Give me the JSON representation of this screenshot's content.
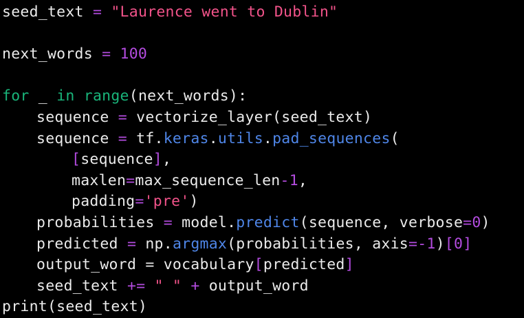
{
  "colors": {
    "background": "#000000",
    "default": "#ebebeb",
    "keyword": "#19b47a",
    "operator": "#b44ce0",
    "string": "#f2538a",
    "number": "#b44ce0",
    "builtin": "#19b47a",
    "attribute": "#4f86e8",
    "bracket": "#b44ce0"
  },
  "code": {
    "lines": [
      {
        "indent": 0,
        "tokens": [
          {
            "t": "seed_text ",
            "k": "default"
          },
          {
            "t": "=",
            "k": "operator"
          },
          {
            "t": " ",
            "k": "default"
          },
          {
            "t": "\"Laurence went to Dublin\"",
            "k": "string"
          }
        ]
      },
      {
        "indent": 0,
        "tokens": []
      },
      {
        "indent": 0,
        "tokens": [
          {
            "t": "next_words ",
            "k": "default"
          },
          {
            "t": "=",
            "k": "operator"
          },
          {
            "t": " ",
            "k": "default"
          },
          {
            "t": "100",
            "k": "number"
          }
        ]
      },
      {
        "indent": 0,
        "tokens": []
      },
      {
        "indent": 0,
        "tokens": [
          {
            "t": "for",
            "k": "keyword"
          },
          {
            "t": " _ ",
            "k": "default"
          },
          {
            "t": "in",
            "k": "keyword"
          },
          {
            "t": " ",
            "k": "default"
          },
          {
            "t": "range",
            "k": "builtin"
          },
          {
            "t": "(next_words):",
            "k": "default"
          }
        ]
      },
      {
        "indent": 1,
        "tokens": [
          {
            "t": "sequence ",
            "k": "default"
          },
          {
            "t": "=",
            "k": "operator"
          },
          {
            "t": " vectorize_layer(seed_text)",
            "k": "default"
          }
        ]
      },
      {
        "indent": 1,
        "tokens": [
          {
            "t": "sequence ",
            "k": "default"
          },
          {
            "t": "=",
            "k": "operator"
          },
          {
            "t": " tf.",
            "k": "default"
          },
          {
            "t": "keras",
            "k": "attribute"
          },
          {
            "t": ".",
            "k": "default"
          },
          {
            "t": "utils",
            "k": "attribute"
          },
          {
            "t": ".",
            "k": "default"
          },
          {
            "t": "pad_sequences",
            "k": "attribute"
          },
          {
            "t": "(",
            "k": "default"
          }
        ]
      },
      {
        "indent": 2,
        "tokens": [
          {
            "t": "[",
            "k": "bracket"
          },
          {
            "t": "sequence",
            "k": "default"
          },
          {
            "t": "]",
            "k": "bracket"
          },
          {
            "t": ",",
            "k": "default"
          }
        ]
      },
      {
        "indent": 2,
        "tokens": [
          {
            "t": "maxlen",
            "k": "default"
          },
          {
            "t": "=",
            "k": "operator"
          },
          {
            "t": "max_sequence_len",
            "k": "default"
          },
          {
            "t": "-",
            "k": "operator"
          },
          {
            "t": "1",
            "k": "number"
          },
          {
            "t": ",",
            "k": "default"
          }
        ]
      },
      {
        "indent": 2,
        "tokens": [
          {
            "t": "padding",
            "k": "default"
          },
          {
            "t": "=",
            "k": "operator"
          },
          {
            "t": "'pre'",
            "k": "string"
          },
          {
            "t": ")",
            "k": "default"
          }
        ]
      },
      {
        "indent": 1,
        "tokens": [
          {
            "t": "probabilities ",
            "k": "default"
          },
          {
            "t": "=",
            "k": "operator"
          },
          {
            "t": " model.",
            "k": "default"
          },
          {
            "t": "predict",
            "k": "attribute"
          },
          {
            "t": "(sequence, verbose",
            "k": "default"
          },
          {
            "t": "=",
            "k": "operator"
          },
          {
            "t": "0",
            "k": "number"
          },
          {
            "t": ")",
            "k": "default"
          }
        ]
      },
      {
        "indent": 1,
        "tokens": [
          {
            "t": "predicted ",
            "k": "default"
          },
          {
            "t": "=",
            "k": "operator"
          },
          {
            "t": " np.",
            "k": "default"
          },
          {
            "t": "argmax",
            "k": "attribute"
          },
          {
            "t": "(probabilities, axis",
            "k": "default"
          },
          {
            "t": "=-",
            "k": "operator"
          },
          {
            "t": "1",
            "k": "number"
          },
          {
            "t": ")",
            "k": "default"
          },
          {
            "t": "[",
            "k": "bracket"
          },
          {
            "t": "0",
            "k": "number"
          },
          {
            "t": "]",
            "k": "bracket"
          }
        ]
      },
      {
        "indent": 1,
        "tokens": [
          {
            "t": "output_word = vocabulary",
            "k": "default"
          },
          {
            "t": "[",
            "k": "bracket"
          },
          {
            "t": "predicted",
            "k": "default"
          },
          {
            "t": "]",
            "k": "bracket"
          }
        ]
      },
      {
        "indent": 1,
        "tokens": [
          {
            "t": "seed_text ",
            "k": "default"
          },
          {
            "t": "+=",
            "k": "operator"
          },
          {
            "t": " ",
            "k": "default"
          },
          {
            "t": "\" \"",
            "k": "string"
          },
          {
            "t": " ",
            "k": "default"
          },
          {
            "t": "+",
            "k": "operator"
          },
          {
            "t": " output_word",
            "k": "default"
          }
        ]
      },
      {
        "indent": 0,
        "tokens": [
          {
            "t": "print(seed_text)",
            "k": "default"
          }
        ]
      }
    ]
  }
}
